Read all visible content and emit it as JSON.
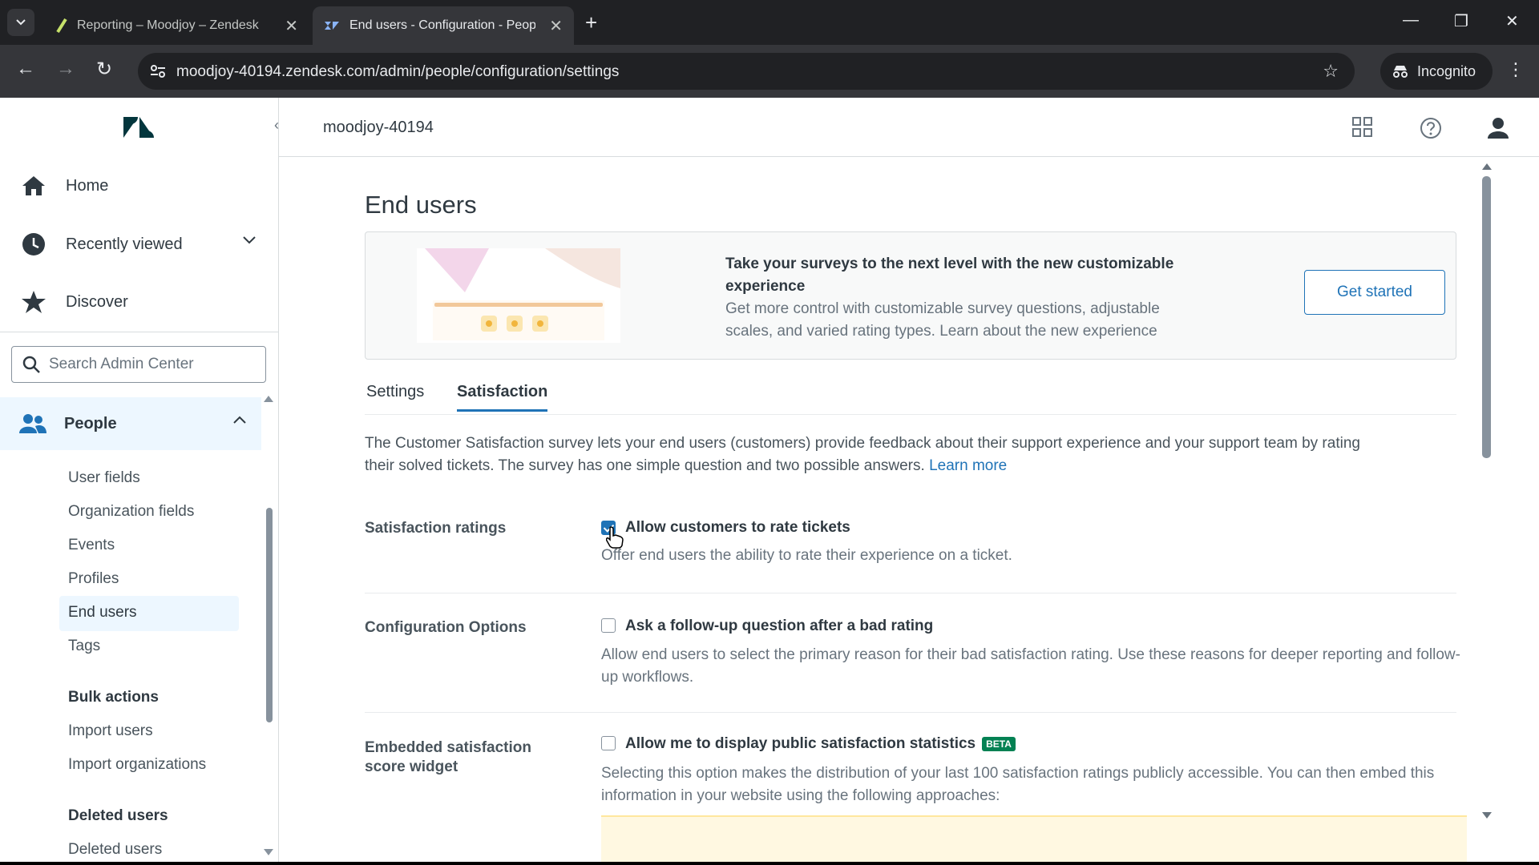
{
  "browser": {
    "tabs": [
      {
        "title": "Reporting – Moodjoy – Zendesk",
        "active": false
      },
      {
        "title": "End users - Configuration - People",
        "active": true
      }
    ],
    "url": "moodjoy-40194.zendesk.com/admin/people/configuration/settings",
    "incognito_label": "Incognito"
  },
  "sidebar": {
    "primary": [
      {
        "label": "Home",
        "icon": "home-icon"
      },
      {
        "label": "Recently viewed",
        "icon": "clock-icon"
      },
      {
        "label": "Discover",
        "icon": "star-icon"
      }
    ],
    "search_placeholder": "Search Admin Center",
    "section": {
      "label": "People",
      "icon": "people-icon"
    },
    "items": [
      "User fields",
      "Organization fields",
      "Events",
      "Profiles",
      "End users",
      "Tags"
    ],
    "active_item": "End users",
    "groups": [
      {
        "heading": "Bulk actions",
        "items": [
          "Import users",
          "Import organizations"
        ]
      },
      {
        "heading": "Deleted users",
        "items": [
          "Deleted users"
        ]
      }
    ]
  },
  "topbar": {
    "account": "moodjoy-40194"
  },
  "page": {
    "title": "End users",
    "banner": {
      "heading": "Take your surveys to the next level with the new customizable experience",
      "body": "Get more control with customizable survey questions, adjustable scales, and varied rating types. Learn about the new experience",
      "button": "Get started"
    },
    "tabs": [
      {
        "label": "Settings",
        "selected": false
      },
      {
        "label": "Satisfaction",
        "selected": true
      }
    ],
    "description": "The Customer Satisfaction survey lets your end users (customers) provide feedback about their support experience and your support team by rating their solved tickets. The survey has one simple question and two possible answers.",
    "learn_more": "Learn more",
    "rows": [
      {
        "label": "Satisfaction ratings",
        "checkbox": "Allow customers to rate tickets",
        "checked": true,
        "hint": "Offer end users the ability to rate their experience on a ticket."
      },
      {
        "label": "Configuration Options",
        "checkbox": "Ask a follow-up question after a bad rating",
        "checked": false,
        "hint": "Allow end users to select the primary reason for their bad satisfaction rating. Use these reasons for deeper reporting and follow-up workflows."
      },
      {
        "label": "Embedded satisfaction score widget",
        "checkbox": "Allow me to display public satisfaction statistics",
        "badge": "BETA",
        "checked": false,
        "hint": "Selecting this option makes the distribution of your last 100 satisfaction ratings publicly accessible. You can then embed this information in your website using the following approaches:"
      }
    ]
  },
  "colors": {
    "accent": "#1f73b7",
    "active_bg": "#edf7ff",
    "beta_badge": "#038153",
    "chrome_dark": "#202124"
  }
}
